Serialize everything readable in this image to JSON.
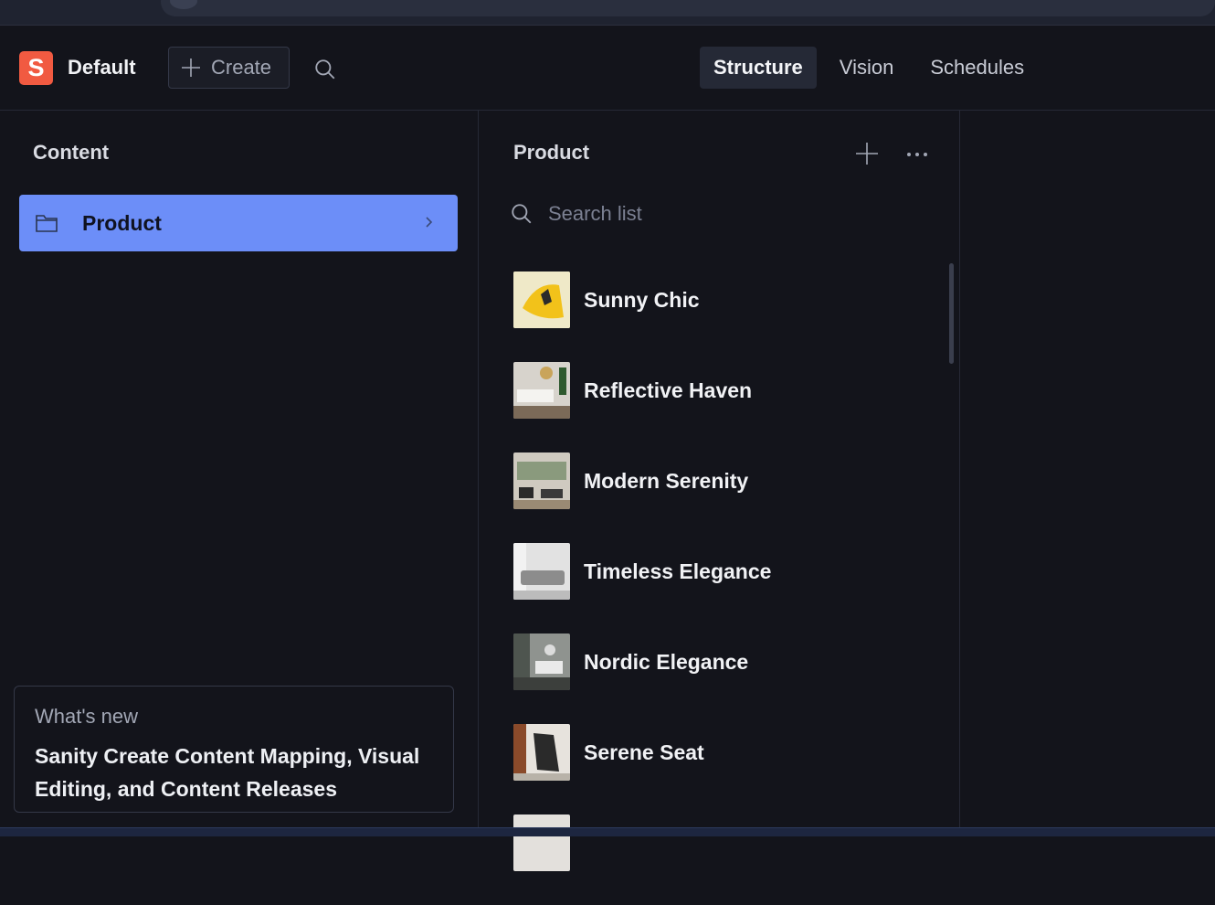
{
  "header": {
    "logo_letter": "S",
    "workspace": "Default",
    "create_label": "Create",
    "tabs": [
      {
        "label": "Structure",
        "active": true
      },
      {
        "label": "Vision",
        "active": false
      },
      {
        "label": "Schedules",
        "active": false
      }
    ]
  },
  "left": {
    "title": "Content",
    "items": [
      {
        "label": "Product",
        "selected": true
      }
    ],
    "whats_new": {
      "label": "What's new",
      "text": "Sanity Create Content Mapping, Visual Editing, and Content Releases"
    }
  },
  "middle": {
    "title": "Product",
    "search_placeholder": "Search list",
    "items": [
      {
        "title": "Sunny Chic"
      },
      {
        "title": "Reflective Haven"
      },
      {
        "title": "Modern Serenity"
      },
      {
        "title": "Timeless Elegance"
      },
      {
        "title": "Nordic Elegance"
      },
      {
        "title": "Serene Seat"
      }
    ]
  },
  "colors": {
    "accent": "#6c8ef8",
    "logo": "#f15a41",
    "background": "#13141b"
  }
}
